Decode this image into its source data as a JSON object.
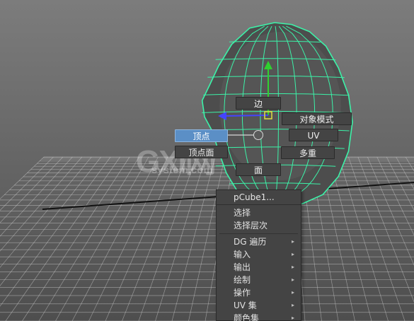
{
  "marking_menu": {
    "north": "边",
    "west": "顶点",
    "southwest": "顶点面",
    "south": "面",
    "northeast": "对象模式",
    "east": "UV",
    "southeast": "多重"
  },
  "context_menu": {
    "title": "pCube1...",
    "items": [
      {
        "label": "选择",
        "submenu": false
      },
      {
        "label": "选择层次",
        "submenu": false
      },
      {
        "label": "DG 遍历",
        "submenu": true
      },
      {
        "label": "输入",
        "submenu": true
      },
      {
        "label": "输出",
        "submenu": true
      },
      {
        "label": "绘制",
        "submenu": true
      },
      {
        "label": "操作",
        "submenu": true
      },
      {
        "label": "UV 集",
        "submenu": true
      },
      {
        "label": "颜色集",
        "submenu": true
      }
    ],
    "submenu_arrow": "▸"
  },
  "watermark": {
    "big": "GXI网",
    "small": "system.com"
  },
  "colors": {
    "wireframe": "#3cf2a8",
    "active_pill": "#5b8fc6",
    "grid": "#cfcfcf"
  }
}
